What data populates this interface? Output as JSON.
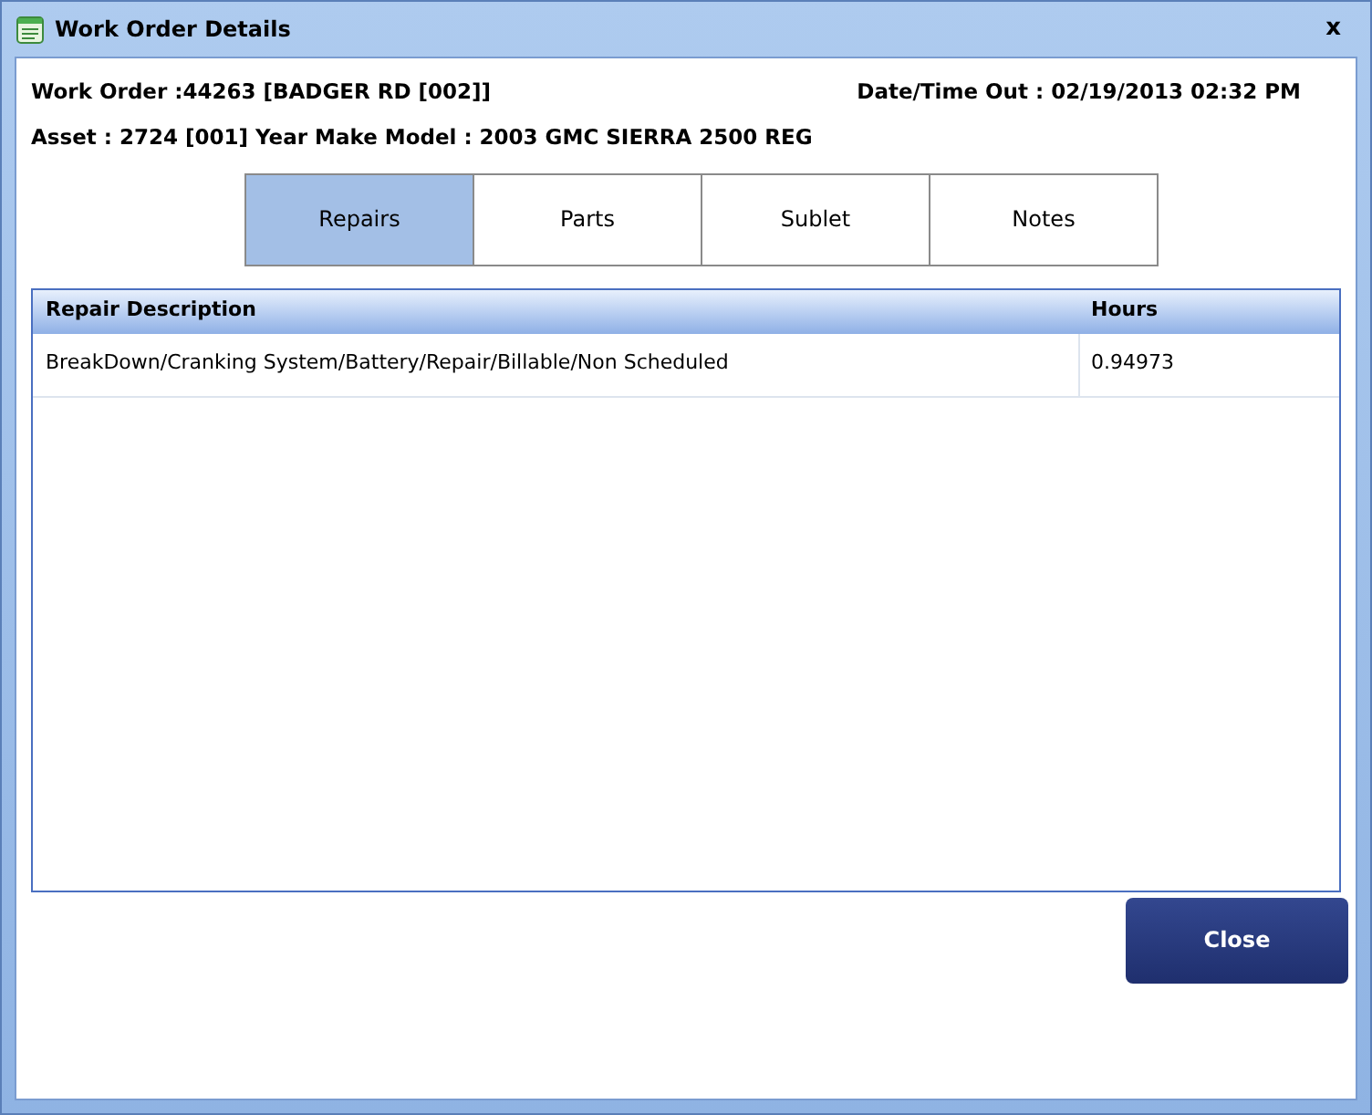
{
  "window": {
    "title": "Work Order Details",
    "close": "x"
  },
  "header": {
    "work_order": "Work Order :44263 [BADGER RD [002]]",
    "date_time_out": "Date/Time Out : 02/19/2013 02:32 PM",
    "asset": "Asset : 2724 [001] Year Make Model : 2003 GMC SIERRA 2500 REG"
  },
  "tabs": [
    {
      "label": "Repairs",
      "selected": true
    },
    {
      "label": "Parts",
      "selected": false
    },
    {
      "label": "Sublet",
      "selected": false
    },
    {
      "label": "Notes",
      "selected": false
    }
  ],
  "table": {
    "columns": [
      "Repair Description",
      "Hours"
    ],
    "rows": [
      [
        "BreakDown/Cranking System/Battery/Repair/Billable/Non Scheduled",
        "0.94973"
      ]
    ]
  },
  "buttons": [
    "Close"
  ]
}
